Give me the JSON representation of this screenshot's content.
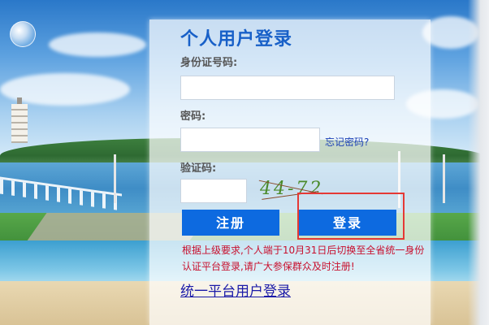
{
  "login": {
    "title": "个人用户登录",
    "id_label": "身份证号码:",
    "id_value": "",
    "password_label": "密码:",
    "password_value": "",
    "forgot_link": "忘记密码?",
    "captcha_label": "验证码:",
    "captcha_value": "",
    "captcha_image_text": "44-72"
  },
  "buttons": {
    "register": "注册",
    "login": "登录"
  },
  "notice": "根据上级要求,个人端于10月31日后切换至全省统一身份认证平台登录,请广大参保群众及时注册!",
  "unified_login_link": "统一平台用户登录",
  "colors": {
    "title": "#1860c8",
    "button": "#0d6ae0",
    "notice": "#c8102e",
    "link": "#1a1aa8",
    "highlight": "#e53935"
  }
}
